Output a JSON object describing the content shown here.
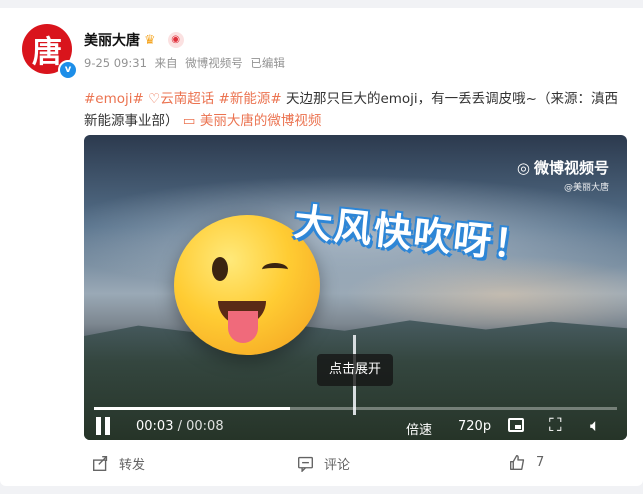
{
  "post": {
    "author": "美丽大唐",
    "avatar_char": "唐",
    "verified_char": "v",
    "date": "9-25 09:31",
    "source_prefix": "来自",
    "source": "微博视频号",
    "edited": "已编辑",
    "tag_emoji": "#emoji#",
    "tag_super": "云南超话",
    "tag_energy": "#新能源#",
    "text_body": "天边那只巨大的emoji，有一丢丢调皮哦~（来源：滇西新能源事业部）",
    "video_link": "美丽大唐的微博视频"
  },
  "video": {
    "overlay_title": "大风快吹呀！",
    "watermark": "微博视频号",
    "watermark_sub": "@美丽大唐",
    "expand_tip": "点击展开",
    "current_time": "00:03",
    "duration": "00:08",
    "speed_label": "倍速",
    "quality_label": "720p",
    "progress_fraction": 0.375
  },
  "actions": {
    "repost": "转发",
    "comment": "评论",
    "like_count": "7"
  },
  "colors": {
    "accent": "#eb7350",
    "verified": "#1d8ee8",
    "avatar_bg": "#d9141c"
  }
}
